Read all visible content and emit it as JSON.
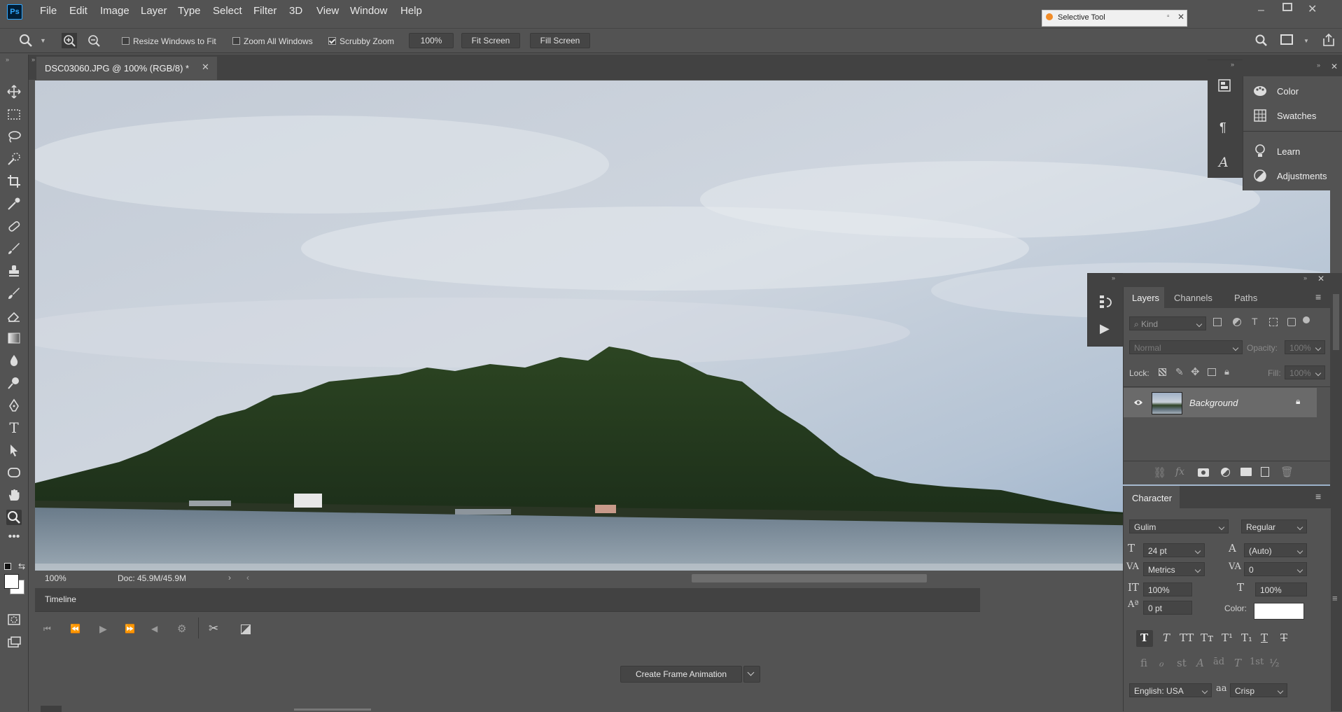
{
  "app": {
    "logo": "Ps"
  },
  "menu": [
    "File",
    "Edit",
    "Image",
    "Layer",
    "Type",
    "Select",
    "Filter",
    "3D",
    "View",
    "Window",
    "Help"
  ],
  "selective_tool": {
    "title": "Selective Tool"
  },
  "options": {
    "resize_windows": "Resize Windows to Fit",
    "zoom_all": "Zoom All Windows",
    "scrubby_zoom": "Scrubby Zoom",
    "zoom_value": "100%",
    "fit_screen": "Fit Screen",
    "fill_screen": "Fill Screen"
  },
  "document": {
    "tab_title": "DSC03060.JPG @ 100% (RGB/8) *"
  },
  "status": {
    "zoom": "100%",
    "doc": "Doc: 45.9M/45.9M"
  },
  "timeline": {
    "title": "Timeline",
    "create_button": "Create Frame Animation"
  },
  "mini_panel": {
    "items": [
      "Color",
      "Swatches",
      "Learn",
      "Adjustments"
    ]
  },
  "layers_panel": {
    "tabs": [
      "Layers",
      "Channels",
      "Paths"
    ],
    "kind_placeholder": "Kind",
    "blend_mode": "Normal",
    "opacity_label": "Opacity:",
    "opacity_value": "100%",
    "lock_label": "Lock:",
    "fill_label": "Fill:",
    "fill_value": "100%",
    "layer_name": "Background"
  },
  "character_panel": {
    "title": "Character",
    "font_family": "Gulim",
    "font_style": "Regular",
    "font_size": "24 pt",
    "leading": "(Auto)",
    "kerning": "Metrics",
    "tracking": "0",
    "vertical_scale": "100%",
    "horizontal_scale": "100%",
    "baseline_shift": "0 pt",
    "color_label": "Color:",
    "language": "English: USA",
    "antialias": "Crisp",
    "style_buttons": [
      "T",
      "T",
      "TT",
      "Tт",
      "T¹",
      "T₁",
      "T",
      "T"
    ],
    "opentype_buttons": [
      "ﬁ",
      "ℴ",
      "st",
      "A",
      "ād",
      "T",
      "1st",
      "½"
    ],
    "aa_label": "aa"
  },
  "colors": {
    "accent": "#31a8ff",
    "panel": "#535353",
    "dark": "#424242"
  }
}
